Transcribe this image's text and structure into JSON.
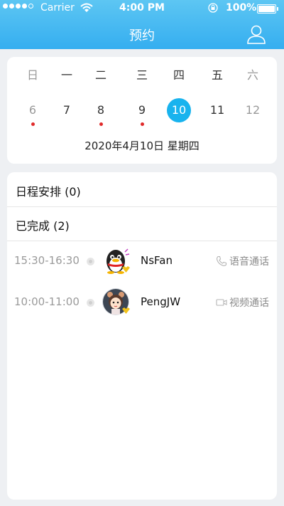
{
  "status_bar": {
    "carrier": "Carrier",
    "time": "4:00 PM",
    "battery": "100%"
  },
  "header": {
    "title": "预约"
  },
  "calendar": {
    "weekdays": [
      "日",
      "一",
      "二",
      "三",
      "四",
      "五",
      "六"
    ],
    "dates": [
      {
        "day": "6",
        "has_event": true
      },
      {
        "day": "7",
        "has_event": false
      },
      {
        "day": "8",
        "has_event": true
      },
      {
        "day": "9",
        "has_event": true
      },
      {
        "day": "10",
        "has_event": false,
        "selected": true
      },
      {
        "day": "11",
        "has_event": false
      },
      {
        "day": "12",
        "has_event": false
      }
    ],
    "selected_label": "2020年4月10日  星期四",
    "accent_color": "#18b3ee",
    "event_dot_color": "#e02a2a"
  },
  "sections": {
    "schedule": "日程安排 (0)",
    "completed": "已完成 (2)"
  },
  "appointments": [
    {
      "time": "15:30-16:30",
      "name": "NsFan",
      "call_type": "语音通话",
      "call_icon": "phone-icon",
      "avatar": "penguin-avatar"
    },
    {
      "time": "10:00-11:00",
      "name": "PengJW",
      "call_type": "视频通话",
      "call_icon": "video-icon",
      "avatar": "cartoon-girl-avatar"
    }
  ]
}
